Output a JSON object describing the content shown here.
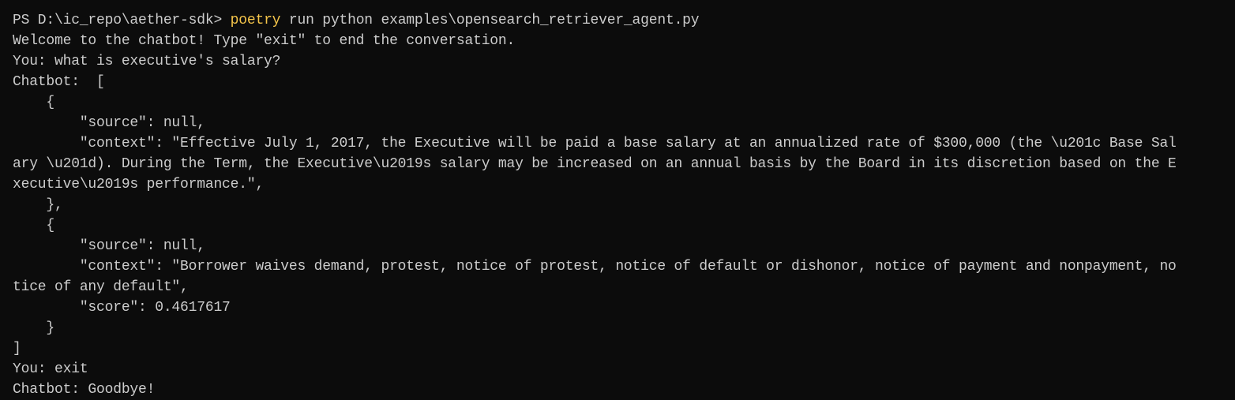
{
  "terminal": {
    "prompt": "PS D:\\ic_repo\\aether-sdk> ",
    "command_keyword": "poetry",
    "command_rest": " run python examples\\opensearch_retriever_agent.py",
    "lines": [
      "Welcome to the chatbot! Type \"exit\" to end the conversation.",
      "You: what is executive's salary?",
      "Chatbot:  [",
      "    {",
      "        \"source\": null,",
      "        \"context\": \"Effective July 1, 2017, the Executive will be paid a base salary at an annualized rate of $300,000 (the \\u201c Base Sal",
      "ary \\u201d). During the Term, the Executive\\u2019s salary may be increased on an annual basis by the Board in its discretion based on the E",
      "xecutive\\u2019s performance.\",",
      "    },",
      "    {",
      "        \"source\": null,",
      "        \"context\": \"Borrower waives demand, protest, notice of protest, notice of default or dishonor, notice of payment and nonpayment, no",
      "tice of any default\",",
      "        \"score\": 0.4617617",
      "    }",
      "]",
      "You: exit",
      "Chatbot: Goodbye!"
    ]
  },
  "colors": {
    "background": "#0c0c0c",
    "foreground": "#cccccc",
    "command_highlight": "#f5c54a"
  }
}
